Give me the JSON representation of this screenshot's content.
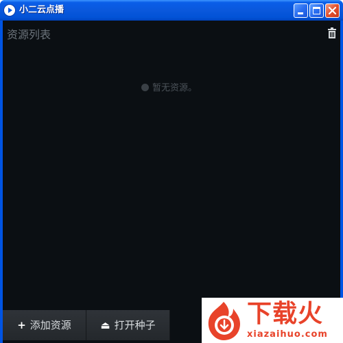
{
  "window": {
    "title": "小二云点播",
    "icons": {
      "app": "play-icon",
      "minimize": "minimize-icon",
      "maximize": "maximize-icon",
      "close": "close-icon"
    }
  },
  "resources": {
    "header": "资源列表",
    "delete_icon": "trash-icon",
    "empty_message": "暂无资源。",
    "empty_icon": "info-icon"
  },
  "toolbar": {
    "add_label": "添加资源",
    "add_icon": "plus-icon",
    "open_label": "打开种子",
    "open_icon": "eject-icon"
  },
  "watermark": {
    "brand": "下载火",
    "site": "xiazaihuo.com",
    "color": "#e8432a"
  },
  "colors": {
    "titlebar": "#0a58dc",
    "content_bg": "#0b0f13",
    "button_bg": "#2a2e33"
  }
}
